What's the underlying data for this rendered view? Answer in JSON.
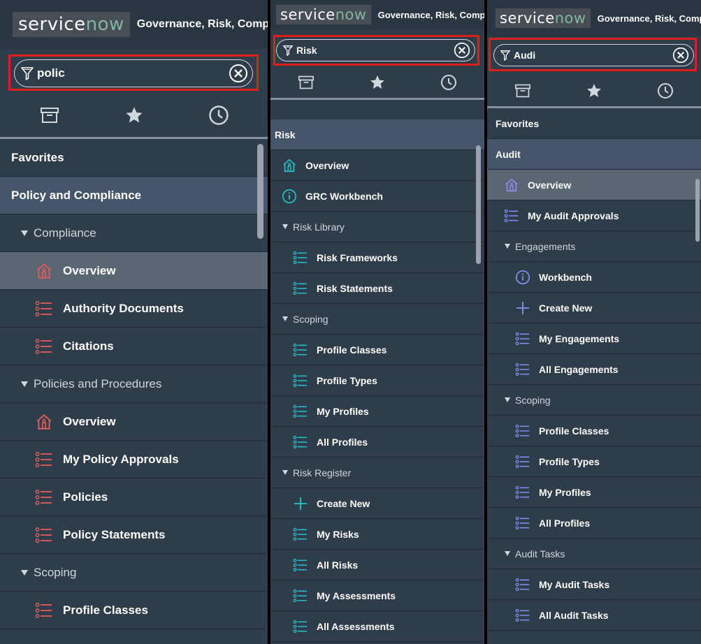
{
  "colors": {
    "accent_red": "#e11d20",
    "icon_red": "#e05c5c",
    "icon_teal": "#22c3c9",
    "icon_purple": "#8d8df2"
  },
  "panel1": {
    "logo_left": "service",
    "logo_now": "now",
    "app_title": "Governance, Risk, Compliance",
    "search": {
      "value": "polic"
    },
    "tabs": [
      "archive-icon",
      "star-icon",
      "clock-icon"
    ],
    "items": [
      {
        "label": "Favorites"
      },
      {
        "label": "Policy and Compliance"
      },
      {
        "label": "Compliance"
      },
      {
        "label": "Overview",
        "icon": "home-icon"
      },
      {
        "label": "Authority Documents",
        "icon": "list-icon"
      },
      {
        "label": "Citations",
        "icon": "list-icon"
      },
      {
        "label": "Policies and Procedures"
      },
      {
        "label": "Overview",
        "icon": "home-icon"
      },
      {
        "label": "My Policy Approvals",
        "icon": "list-icon"
      },
      {
        "label": "Policies",
        "icon": "list-icon"
      },
      {
        "label": "Policy Statements",
        "icon": "list-icon"
      },
      {
        "label": "Scoping"
      },
      {
        "label": "Profile Classes",
        "icon": "list-icon"
      }
    ]
  },
  "panel2": {
    "logo_left": "service",
    "logo_now": "now",
    "app_title": "Governance, Risk, Compliance",
    "search": {
      "value": "Risk"
    },
    "tabs": [
      "archive-icon",
      "star-icon",
      "clock-icon"
    ],
    "items": [
      {
        "label": "Risk"
      },
      {
        "label": "Overview",
        "icon": "home-icon"
      },
      {
        "label": "GRC Workbench",
        "icon": "info-icon"
      },
      {
        "label": "Risk Library"
      },
      {
        "label": "Risk Frameworks",
        "icon": "list-icon"
      },
      {
        "label": "Risk Statements",
        "icon": "list-icon"
      },
      {
        "label": "Scoping"
      },
      {
        "label": "Profile Classes",
        "icon": "list-icon"
      },
      {
        "label": "Profile Types",
        "icon": "list-icon"
      },
      {
        "label": "My Profiles",
        "icon": "list-icon"
      },
      {
        "label": "All Profiles",
        "icon": "list-icon"
      },
      {
        "label": "Risk Register"
      },
      {
        "label": "Create New",
        "icon": "plus-icon"
      },
      {
        "label": "My Risks",
        "icon": "list-icon"
      },
      {
        "label": "All Risks",
        "icon": "list-icon"
      },
      {
        "label": "My Assessments",
        "icon": "list-icon"
      },
      {
        "label": "All Assessments",
        "icon": "list-icon"
      }
    ]
  },
  "panel3": {
    "logo_left": "service",
    "logo_now": "now",
    "app_title": "Governance, Risk, Compliance",
    "search": {
      "value": "Audi"
    },
    "tabs": [
      "archive-icon",
      "star-icon",
      "clock-icon"
    ],
    "items": [
      {
        "label": "Favorites"
      },
      {
        "label": "Audit"
      },
      {
        "label": "Overview",
        "icon": "home-icon"
      },
      {
        "label": "My Audit Approvals",
        "icon": "list-icon"
      },
      {
        "label": "Engagements"
      },
      {
        "label": "Workbench",
        "icon": "info-icon"
      },
      {
        "label": "Create New",
        "icon": "plus-icon"
      },
      {
        "label": "My Engagements",
        "icon": "list-icon"
      },
      {
        "label": "All Engagements",
        "icon": "list-icon"
      },
      {
        "label": "Scoping"
      },
      {
        "label": "Profile Classes",
        "icon": "list-icon"
      },
      {
        "label": "Profile Types",
        "icon": "list-icon"
      },
      {
        "label": "My Profiles",
        "icon": "list-icon"
      },
      {
        "label": "All Profiles",
        "icon": "list-icon"
      },
      {
        "label": "Audit Tasks"
      },
      {
        "label": "My Audit Tasks",
        "icon": "list-icon"
      },
      {
        "label": "All Audit Tasks",
        "icon": "list-icon"
      }
    ]
  }
}
